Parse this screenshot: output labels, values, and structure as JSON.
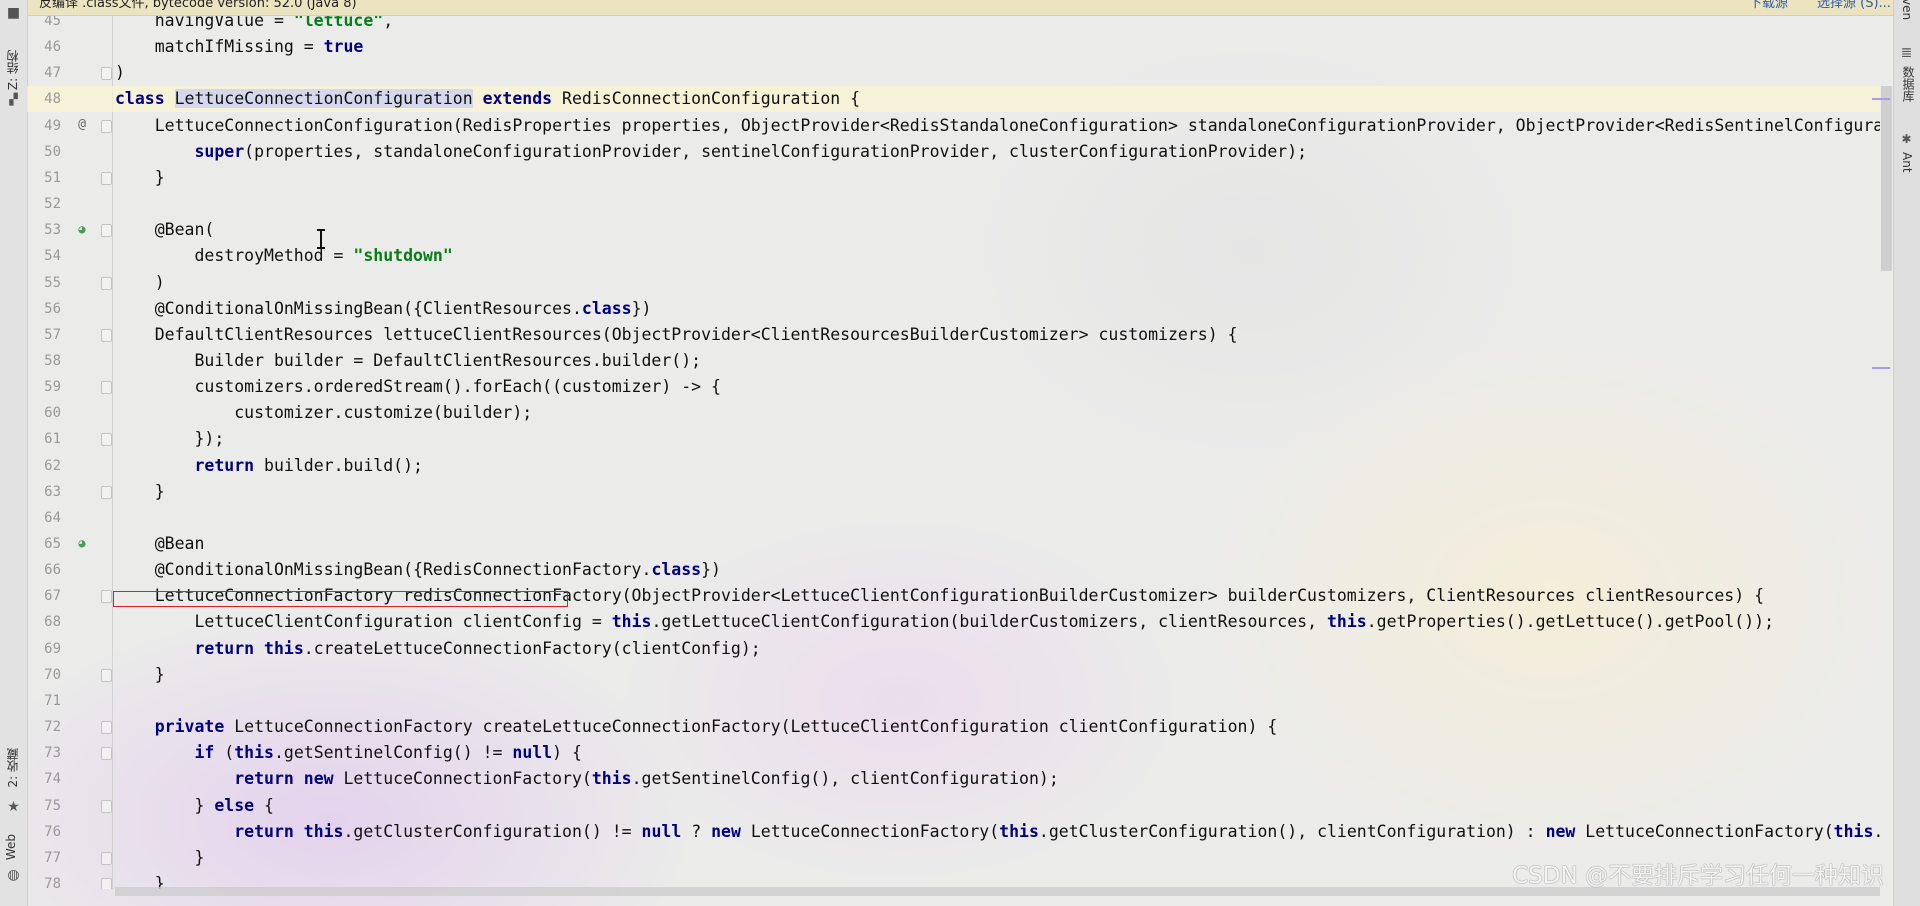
{
  "banner": {
    "text": "反编译 .class文件, bytecode version: 52.0 (Java 8)",
    "download_link": "下载源",
    "choose_link": "选择源 (S)..."
  },
  "left_toolbar": {
    "structure_label": "Z: 结构",
    "favorites_label": "2: 收藏",
    "web_label": "Web",
    "icons": [
      "folder-icon",
      "structure-icon",
      "star-icon",
      "globe-icon"
    ]
  },
  "right_toolbar": {
    "maven_label": "ven",
    "database_label": "数据库",
    "ant_label": "Ant",
    "icons": [
      "database-icon",
      "ant-icon"
    ]
  },
  "colors": {
    "keyword": "#000080",
    "string": "#067d17",
    "highlight_box": "#e02020"
  },
  "watermark": "CSDN @不要排斥学习任何一种知识",
  "current_line": 48,
  "gutter_icons": {
    "49": "at-sign-icon",
    "53": "bean-icon",
    "65": "bean-icon"
  },
  "fold_lines": [
    47,
    49,
    51,
    53,
    55,
    57,
    59,
    61,
    63,
    67,
    70,
    72,
    73,
    75,
    77,
    78
  ],
  "lines": [
    {
      "n": "45",
      "t": [
        [
          "t",
          "    havingValue = "
        ],
        [
          "s",
          "\"lettuce\""
        ],
        [
          "t",
          ","
        ]
      ]
    },
    {
      "n": "46",
      "t": [
        [
          "t",
          "    matchIfMissing = "
        ],
        [
          "k",
          "true"
        ]
      ]
    },
    {
      "n": "47",
      "t": [
        [
          "t",
          ")"
        ]
      ]
    },
    {
      "n": "48",
      "t": [
        [
          "k",
          "class"
        ],
        [
          "t",
          " "
        ],
        [
          "h",
          "LettuceConnectionConfiguration"
        ],
        [
          "t",
          " "
        ],
        [
          "k",
          "extends"
        ],
        [
          "t",
          " RedisConnectionConfiguration {"
        ]
      ]
    },
    {
      "n": "49",
      "t": [
        [
          "t",
          "    LettuceConnectionConfiguration(RedisProperties properties, ObjectProvider<RedisStandaloneConfiguration> standaloneConfigurationProvider, ObjectProvider<RedisSentinelConfigura"
        ]
      ]
    },
    {
      "n": "50",
      "t": [
        [
          "t",
          "        "
        ],
        [
          "k",
          "super"
        ],
        [
          "t",
          "(properties, standaloneConfigurationProvider, sentinelConfigurationProvider, clusterConfigurationProvider);"
        ]
      ]
    },
    {
      "n": "51",
      "t": [
        [
          "t",
          "    }"
        ]
      ]
    },
    {
      "n": "52",
      "t": []
    },
    {
      "n": "53",
      "t": [
        [
          "t",
          "    @Bean("
        ]
      ]
    },
    {
      "n": "54",
      "t": [
        [
          "t",
          "        destroyMethod = "
        ],
        [
          "s",
          "\"shutdown\""
        ]
      ]
    },
    {
      "n": "55",
      "t": [
        [
          "t",
          "    )"
        ]
      ]
    },
    {
      "n": "56",
      "t": [
        [
          "t",
          "    @ConditionalOnMissingBean({ClientResources."
        ],
        [
          "k",
          "class"
        ],
        [
          "t",
          "})"
        ]
      ]
    },
    {
      "n": "57",
      "t": [
        [
          "t",
          "    DefaultClientResources lettuceClientResources(ObjectProvider<ClientResourcesBuilderCustomizer> customizers) {"
        ]
      ]
    },
    {
      "n": "58",
      "t": [
        [
          "t",
          "        Builder builder = DefaultClientResources.builder();"
        ]
      ]
    },
    {
      "n": "59",
      "t": [
        [
          "t",
          "        customizers.orderedStream().forEach((customizer) -> {"
        ]
      ]
    },
    {
      "n": "60",
      "t": [
        [
          "t",
          "            customizer.customize(builder);"
        ]
      ]
    },
    {
      "n": "61",
      "t": [
        [
          "t",
          "        });"
        ]
      ]
    },
    {
      "n": "62",
      "t": [
        [
          "t",
          "        "
        ],
        [
          "k",
          "return"
        ],
        [
          "t",
          " builder.build();"
        ]
      ]
    },
    {
      "n": "63",
      "t": [
        [
          "t",
          "    }"
        ]
      ]
    },
    {
      "n": "64",
      "t": []
    },
    {
      "n": "65",
      "t": [
        [
          "t",
          "    @Bean"
        ]
      ]
    },
    {
      "n": "66",
      "t": [
        [
          "t",
          "    @ConditionalOnMissingBean({RedisConnectionFactory."
        ],
        [
          "k",
          "class"
        ],
        [
          "t",
          "})"
        ]
      ]
    },
    {
      "n": "67",
      "t": [
        [
          "t",
          "    LettuceConnectionFactory redisConnectionFactory(ObjectProvider<LettuceClientConfigurationBuilderCustomizer> builderCustomizers, ClientResources clientResources) {"
        ]
      ]
    },
    {
      "n": "68",
      "t": [
        [
          "t",
          "        LettuceClientConfiguration clientConfig = "
        ],
        [
          "k",
          "this"
        ],
        [
          "t",
          ".getLettuceClientConfiguration(builderCustomizers, clientResources, "
        ],
        [
          "k",
          "this"
        ],
        [
          "t",
          ".getProperties().getLettuce().getPool());"
        ]
      ]
    },
    {
      "n": "69",
      "t": [
        [
          "t",
          "        "
        ],
        [
          "k",
          "return this"
        ],
        [
          "t",
          ".createLettuceConnectionFactory(clientConfig);"
        ]
      ]
    },
    {
      "n": "70",
      "t": [
        [
          "t",
          "    }"
        ]
      ]
    },
    {
      "n": "71",
      "t": []
    },
    {
      "n": "72",
      "t": [
        [
          "t",
          "    "
        ],
        [
          "k",
          "private"
        ],
        [
          "t",
          " LettuceConnectionFactory createLettuceConnectionFactory(LettuceClientConfiguration clientConfiguration) {"
        ]
      ]
    },
    {
      "n": "73",
      "t": [
        [
          "t",
          "        "
        ],
        [
          "k",
          "if"
        ],
        [
          "t",
          " ("
        ],
        [
          "k",
          "this"
        ],
        [
          "t",
          ".getSentinelConfig() != "
        ],
        [
          "k",
          "null"
        ],
        [
          "t",
          ") {"
        ]
      ]
    },
    {
      "n": "74",
      "t": [
        [
          "t",
          "            "
        ],
        [
          "k",
          "return new"
        ],
        [
          "t",
          " LettuceConnectionFactory("
        ],
        [
          "k",
          "this"
        ],
        [
          "t",
          ".getSentinelConfig(), clientConfiguration);"
        ]
      ]
    },
    {
      "n": "75",
      "t": [
        [
          "t",
          "        } "
        ],
        [
          "k",
          "else"
        ],
        [
          "t",
          " {"
        ]
      ]
    },
    {
      "n": "76",
      "t": [
        [
          "t",
          "            "
        ],
        [
          "k",
          "return this"
        ],
        [
          "t",
          ".getClusterConfiguration() != "
        ],
        [
          "k",
          "null"
        ],
        [
          "t",
          " ? "
        ],
        [
          "k",
          "new"
        ],
        [
          "t",
          " LettuceConnectionFactory("
        ],
        [
          "k",
          "this"
        ],
        [
          "t",
          ".getClusterConfiguration(), clientConfiguration) : "
        ],
        [
          "k",
          "new"
        ],
        [
          "t",
          " LettuceConnectionFactory("
        ],
        [
          "k",
          "this"
        ],
        [
          "t",
          "."
        ]
      ]
    },
    {
      "n": "77",
      "t": [
        [
          "t",
          "        }"
        ]
      ]
    },
    {
      "n": "78",
      "t": [
        [
          "t",
          "    }"
        ]
      ]
    }
  ]
}
